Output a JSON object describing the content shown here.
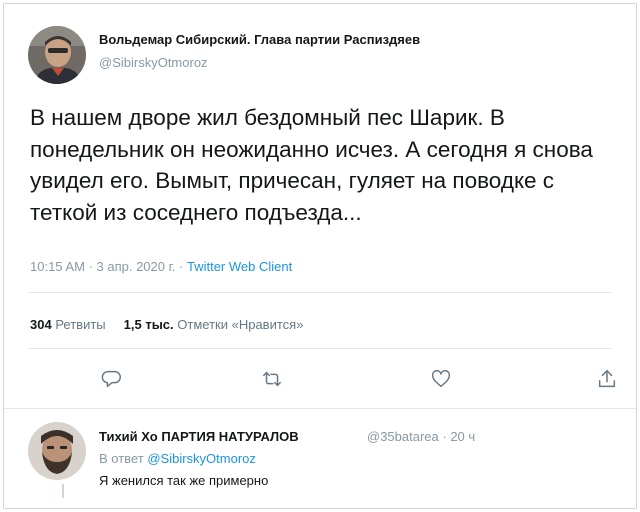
{
  "tweet": {
    "author_name": "Вольдемар Сибирский. Глава партии Распиздяев",
    "author_handle": "@SibirskyOtmoroz",
    "text": "В нашем дворе жил бездомный пес Шарик. В понедельник он неожиданно исчез. А сегодня я снова увидел его. Вымыт, причесан, гуляет на поводке с теткой из соседнего подъезда...",
    "time": "10:15 AM",
    "date": "3 апр. 2020 г.",
    "client": "Twitter Web Client",
    "retweets_count": "304",
    "retweets_label": "Ретвиты",
    "likes_count": "1,5 тыс.",
    "likes_label": "Отметки «Нравится»"
  },
  "actions": {
    "icons": [
      "reply-icon",
      "retweet-icon",
      "like-icon",
      "share-icon"
    ]
  },
  "reply": {
    "author_name": "Тихий Хо ПАРТИЯ НАТУРАЛОВ",
    "author_handle": "@35batarea",
    "time_ago": "20 ч",
    "in_reply_prefix": "В ответ",
    "in_reply_handle": "@SibirskyOtmoroz",
    "text": "Я женился так же примерно"
  },
  "colors": {
    "text": "#14171a",
    "secondary": "#8899a6",
    "link": "#1b95e0",
    "divider": "#e1e8ed"
  }
}
